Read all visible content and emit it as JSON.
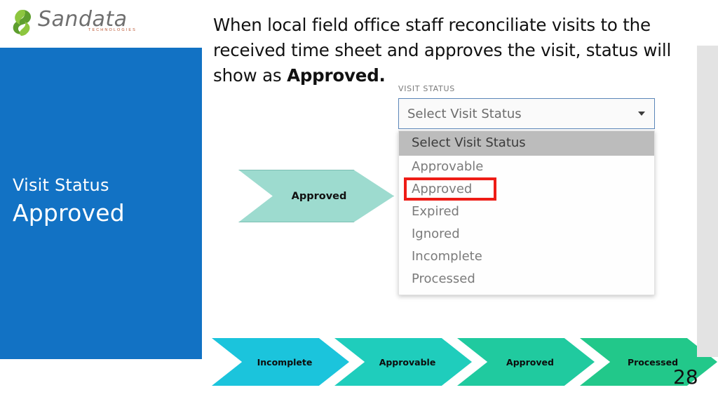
{
  "logo": {
    "wordmark": "Sandata",
    "tagline": "TECHNOLOGIES",
    "mark_name": "sandata-s-leaf-logo"
  },
  "panel": {
    "kicker": "Visit Status",
    "title": "Approved",
    "background_color": "#1272c4"
  },
  "body": {
    "line1": "When local field office staff reconciliate visits to the",
    "line2": "received time sheet and approves the visit, status will",
    "line3_prefix": "show as ",
    "line3_bold": "Approved."
  },
  "mid_chevron": {
    "label": "Approved",
    "fill": "#9ddbcf",
    "stroke": "#7cbfb3"
  },
  "visit_status": {
    "label": "VISIT STATUS",
    "field_value": "Select Visit Status",
    "caret_icon": "chevron-down-icon",
    "options": [
      {
        "label": "Select Visit Status",
        "state": "selected"
      },
      {
        "label": "Approvable",
        "state": "normal"
      },
      {
        "label": "Approved",
        "state": "highlighted"
      },
      {
        "label": "Expired",
        "state": "normal"
      },
      {
        "label": "Ignored",
        "state": "normal"
      },
      {
        "label": "Incomplete",
        "state": "normal"
      },
      {
        "label": "Processed",
        "state": "normal"
      }
    ],
    "highlight_color": "#ee1c16",
    "border_color": "#5b86b8"
  },
  "flow": {
    "steps": [
      {
        "label": "Incomplete",
        "color": "#1bc4dc"
      },
      {
        "label": "Approvable",
        "color": "#1fcdbc"
      },
      {
        "label": "Approved",
        "color": "#20ca9f"
      },
      {
        "label": "Processed",
        "color": "#22c88a"
      }
    ]
  },
  "page": {
    "number": "28"
  }
}
